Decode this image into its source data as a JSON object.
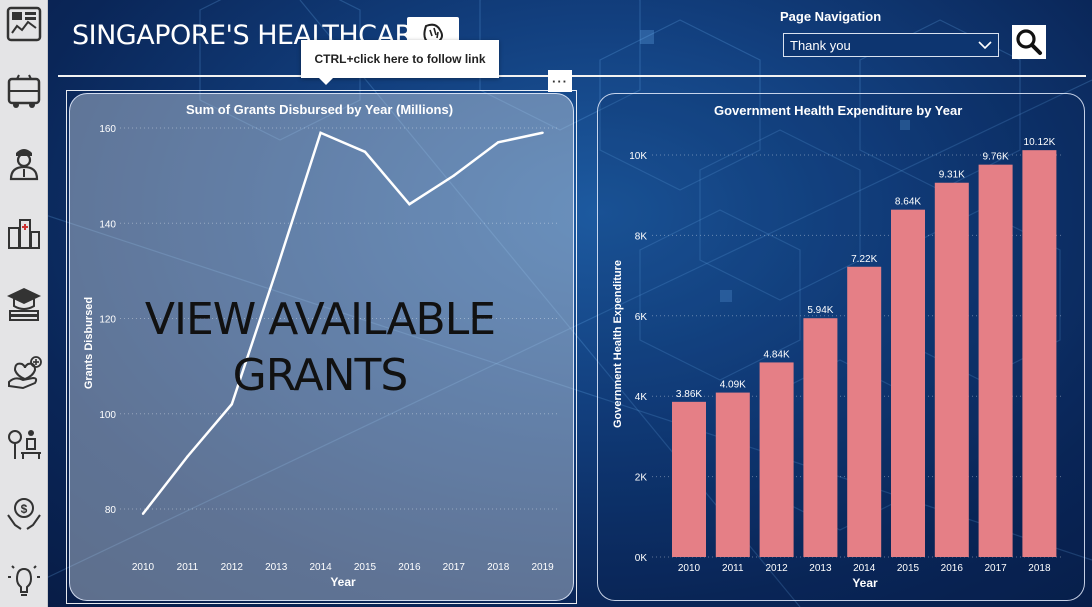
{
  "header": {
    "title": "SINGAPORE'S HEALTHCARE",
    "page_nav_label": "Page Navigation",
    "page_nav_selected": "Thank you",
    "tooltip": "CTRL+click here to follow link",
    "more_options": "···"
  },
  "nav": {
    "icons": [
      "dashboard-icon",
      "bus-icon",
      "doctor-icon",
      "hospital-buildings-icon",
      "education-icon",
      "health-care-hand-icon",
      "elderly-park-icon",
      "money-hand-icon",
      "lightbulb-icon"
    ]
  },
  "left_panel": {
    "overlay_line1": "VIEW AVAILABLE",
    "overlay_line2": "GRANTS"
  },
  "chart_data": [
    {
      "type": "line",
      "title": "Sum of Grants Disbursed by Year (Millions)",
      "xlabel": "Year",
      "ylabel": "Grants Disbursed",
      "x": [
        "2010",
        "2011",
        "2012",
        "2013",
        "2014",
        "2015",
        "2016",
        "2017",
        "2018",
        "2019"
      ],
      "values": [
        79,
        91,
        102,
        130,
        159,
        155,
        144,
        150,
        157,
        159
      ],
      "yticks": [
        "80",
        "100",
        "120",
        "140",
        "160"
      ],
      "ylim": [
        76,
        162
      ],
      "line_color": "#ffffff"
    },
    {
      "type": "bar",
      "title": "Government Health Expenditure by Year",
      "xlabel": "Year",
      "ylabel": "Government Health Expenditure",
      "categories": [
        "2010",
        "2011",
        "2012",
        "2013",
        "2014",
        "2015",
        "2016",
        "2017",
        "2018"
      ],
      "values": [
        3860,
        4090,
        4840,
        5940,
        7220,
        8640,
        9310,
        9760,
        10120
      ],
      "labels": [
        "3.86K",
        "4.09K",
        "4.84K",
        "5.94K",
        "7.22K",
        "8.64K",
        "9.31K",
        "9.76K",
        "10.12K"
      ],
      "yticks": [
        "0K",
        "2K",
        "4K",
        "6K",
        "8K",
        "10K"
      ],
      "ylim": [
        0,
        10000
      ],
      "bar_color": "#e57f86"
    }
  ]
}
